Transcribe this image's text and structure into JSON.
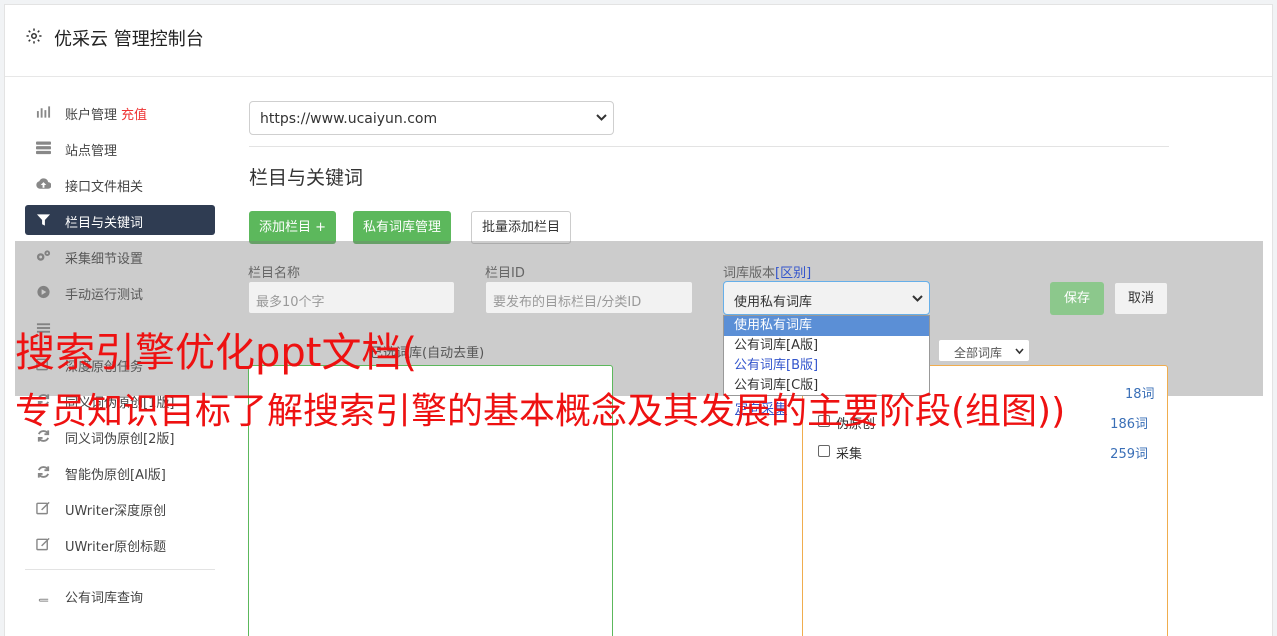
{
  "header": {
    "title": "优采云 管理控制台",
    "icon": "gear-icon"
  },
  "sidebar": {
    "items": [
      {
        "label": "账户管理",
        "extra": "充值",
        "icon": "bar-chart-icon"
      },
      {
        "label": "站点管理",
        "icon": "server-icon"
      },
      {
        "label": "接口文件相关",
        "icon": "cloud-upload-icon"
      },
      {
        "label": "栏目与关键词",
        "icon": "filter-icon",
        "active": true
      },
      {
        "label": "采集细节设置",
        "icon": "gears-icon"
      },
      {
        "label": "手动运行测试",
        "icon": "play-icon"
      },
      {
        "label": "",
        "icon": "list-icon"
      },
      {
        "label": "深度原创任务",
        "icon": "edit-icon"
      },
      {
        "label": "同义词伪原创[1版]",
        "icon": "refresh-icon"
      },
      {
        "label": "同义词伪原创[2版]",
        "icon": "refresh-icon"
      },
      {
        "label": "智能伪原创[AI版]",
        "icon": "refresh-icon"
      },
      {
        "label": "UWriter深度原创",
        "icon": "edit-icon"
      },
      {
        "label": "UWriter原创标题",
        "icon": "edit-icon"
      }
    ],
    "bottom_items": [
      {
        "label": "公有词库查询",
        "icon": "book-icon"
      }
    ]
  },
  "main": {
    "site_select": "https://www.ucaiyun.com",
    "section_title": "栏目与关键词",
    "buttons": {
      "add_column": "添加栏目 +",
      "private_lib": "私有词库管理",
      "batch_add": "批量添加栏目"
    },
    "form": {
      "name_label": "栏目名称",
      "name_placeholder": "最多10个字",
      "id_label": "栏目ID",
      "id_placeholder": "要发布的目标栏目/分类ID",
      "lib_label": "词库版本",
      "lib_label_link": "[区别]",
      "lib_value": "使用私有词库",
      "save": "保存",
      "cancel": "取消"
    },
    "dropdown_options": [
      "使用私有词库",
      "公有词库[A版]",
      "公有词库[B版]",
      "公有词库[C版]"
    ],
    "custom_link": "定向采集",
    "chosen_label": "已选词库(自动去重)",
    "all_lib_select": "全部词库",
    "libraries": [
      {
        "name": "伪原创",
        "count": "186词"
      },
      {
        "name": "采集",
        "count": "259词"
      }
    ],
    "first_lib_count": "18词"
  },
  "watermark": {
    "line1": "搜索引擎优化ppt文档(",
    "line2": "专员知识目标了解搜索引擎的基本概念及其发展的主要阶段(组图))"
  },
  "colors": {
    "accent_green": "#5cb85c",
    "active_nav": "#2f3c52",
    "watermark_red": "#ee1111",
    "link_blue": "#3a6fb7"
  }
}
